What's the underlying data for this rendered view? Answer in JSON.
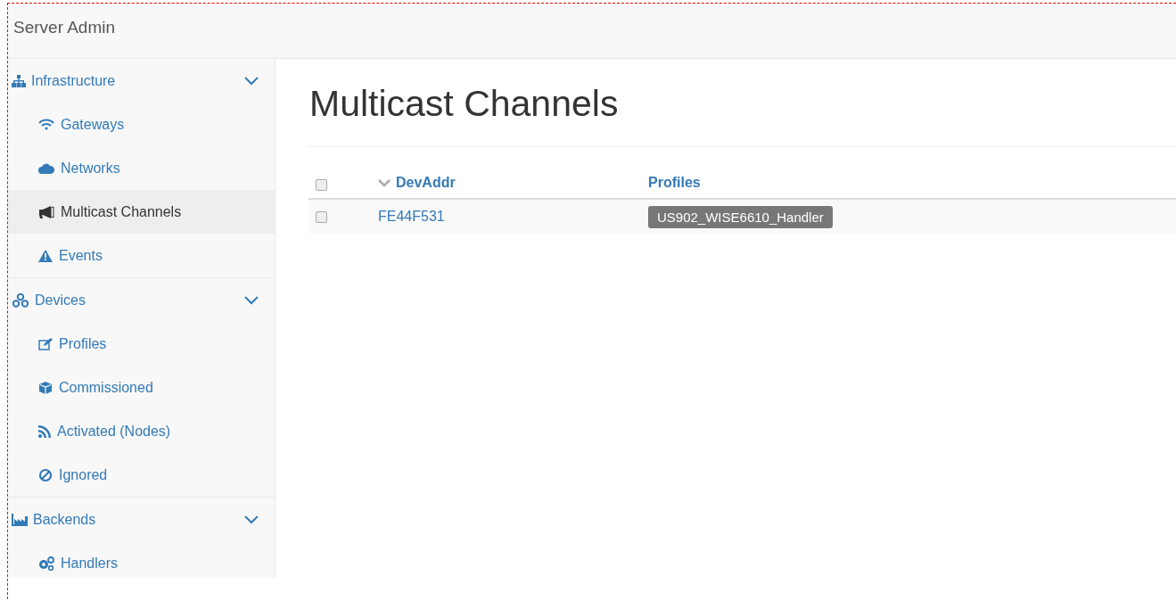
{
  "navbar": {
    "brand": "Server Admin"
  },
  "sidebar": {
    "groups": [
      {
        "label": "Infrastructure",
        "expanded": true,
        "items": [
          {
            "label": "Gateways",
            "selected": false
          },
          {
            "label": "Networks",
            "selected": false
          },
          {
            "label": "Multicast Channels",
            "selected": true
          },
          {
            "label": "Events",
            "selected": false
          }
        ]
      },
      {
        "label": "Devices",
        "expanded": true,
        "items": [
          {
            "label": "Profiles",
            "selected": false
          },
          {
            "label": "Commissioned",
            "selected": false
          },
          {
            "label": "Activated (Nodes)",
            "selected": false
          },
          {
            "label": "Ignored",
            "selected": false
          }
        ]
      },
      {
        "label": "Backends",
        "expanded": true,
        "items": [
          {
            "label": "Handlers",
            "selected": false
          }
        ]
      }
    ]
  },
  "page": {
    "title": "Multicast Channels"
  },
  "table": {
    "columns": [
      {
        "label": "DevAddr",
        "sorted": true
      },
      {
        "label": "Profiles",
        "sorted": false
      }
    ],
    "select_all": {
      "checked": false
    },
    "rows": [
      {
        "checked": false,
        "devaddr": "FE44F531",
        "profiles": [
          "US902_WISE6610_Handler"
        ]
      }
    ]
  }
}
